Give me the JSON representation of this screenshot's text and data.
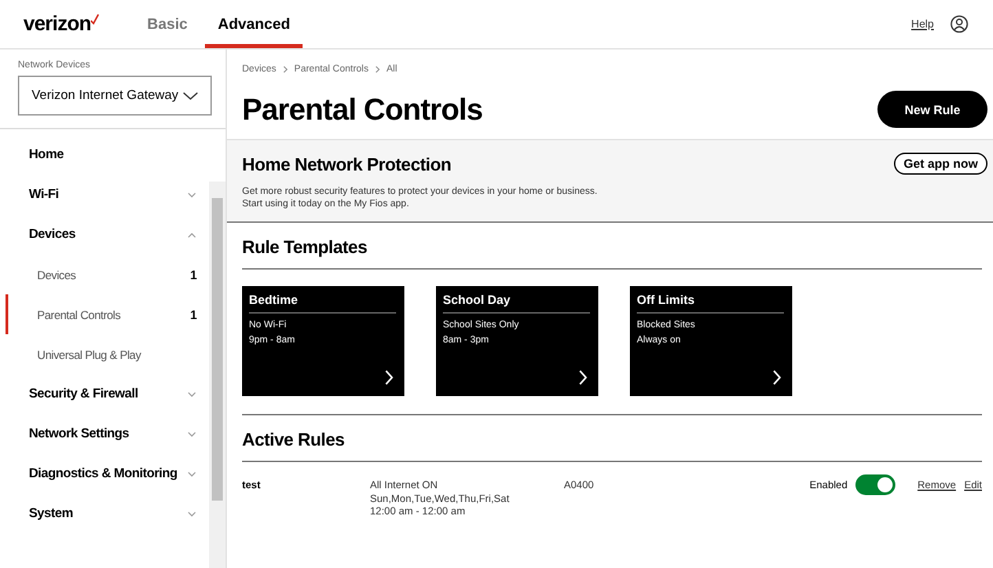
{
  "header": {
    "logo": "verizon",
    "tabs": [
      {
        "label": "Basic",
        "selected": false
      },
      {
        "label": "Advanced",
        "selected": true
      }
    ],
    "help": "Help"
  },
  "sidebar": {
    "device_label": "Network Devices",
    "device_select": "Verizon Internet Gateway",
    "items": [
      {
        "label": "Home",
        "selected": false
      },
      {
        "label": "Wi-Fi",
        "expanded": false,
        "selected": false
      },
      {
        "label": "Devices",
        "expanded": true,
        "selected": false,
        "children": [
          {
            "label": "Devices",
            "count": "1",
            "selected": false
          },
          {
            "label": "Parental Controls",
            "count": "1",
            "selected": true
          },
          {
            "label": "Universal Plug & Play",
            "selected": false
          }
        ]
      },
      {
        "label": "Security & Firewall",
        "expanded": false,
        "selected": false
      },
      {
        "label": "Network Settings",
        "expanded": false,
        "selected": false
      },
      {
        "label": "Diagnostics & Monitoring",
        "expanded": false,
        "selected": false
      },
      {
        "label": "System",
        "expanded": false,
        "selected": false
      }
    ]
  },
  "breadcrumb": [
    "Devices",
    "Parental Controls",
    "All"
  ],
  "title": "Parental Controls",
  "new_rule_button": "New Rule",
  "protection": {
    "title": "Home Network Protection",
    "lines": [
      "Get more robust security features to protect your devices in your home or business.",
      "Start using it today on the My Fios app."
    ],
    "button": "Get app now"
  },
  "rule_templates": {
    "title": "Rule Templates",
    "cards": [
      {
        "title": "Bedtime",
        "lines": [
          "No Wi-Fi",
          "9pm - 8am"
        ]
      },
      {
        "title": "School Day",
        "lines": [
          "School Sites Only",
          "8am - 3pm"
        ]
      },
      {
        "title": "Off Limits",
        "lines": [
          "Blocked Sites",
          "Always on"
        ]
      }
    ]
  },
  "active_rules": {
    "title": "Active Rules",
    "rows": [
      {
        "name": "test",
        "details": [
          "All Internet ON",
          "Sun,Mon,Tue,Wed,Thu,Fri,Sat",
          "12:00 am - 12:00 am"
        ],
        "device": "A0400",
        "status": "Enabled",
        "on": true,
        "remove": "Remove",
        "edit": "Edit"
      }
    ]
  }
}
